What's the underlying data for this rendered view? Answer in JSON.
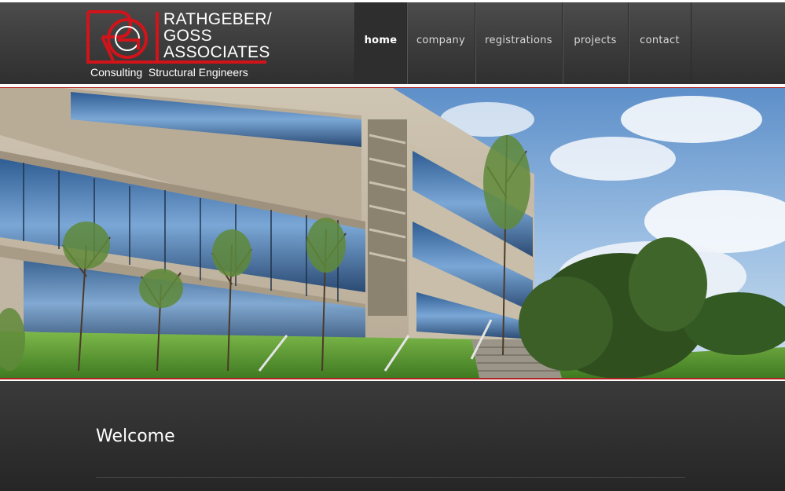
{
  "brand": {
    "line1": "RATHGEBER/",
    "line2": "GOSS",
    "line3": "ASSOCIATES",
    "tagline": "Consulting  Structural Engineers",
    "logo_icon": "rga-monogram-icon",
    "accent_color": "#d0141a"
  },
  "nav": {
    "items": [
      {
        "label": "home",
        "active": true
      },
      {
        "label": "company"
      },
      {
        "label": "registrations"
      },
      {
        "label": "projects"
      },
      {
        "label": "contact"
      }
    ]
  },
  "hero": {
    "image": "office-building-photo"
  },
  "content": {
    "title": "Welcome"
  }
}
